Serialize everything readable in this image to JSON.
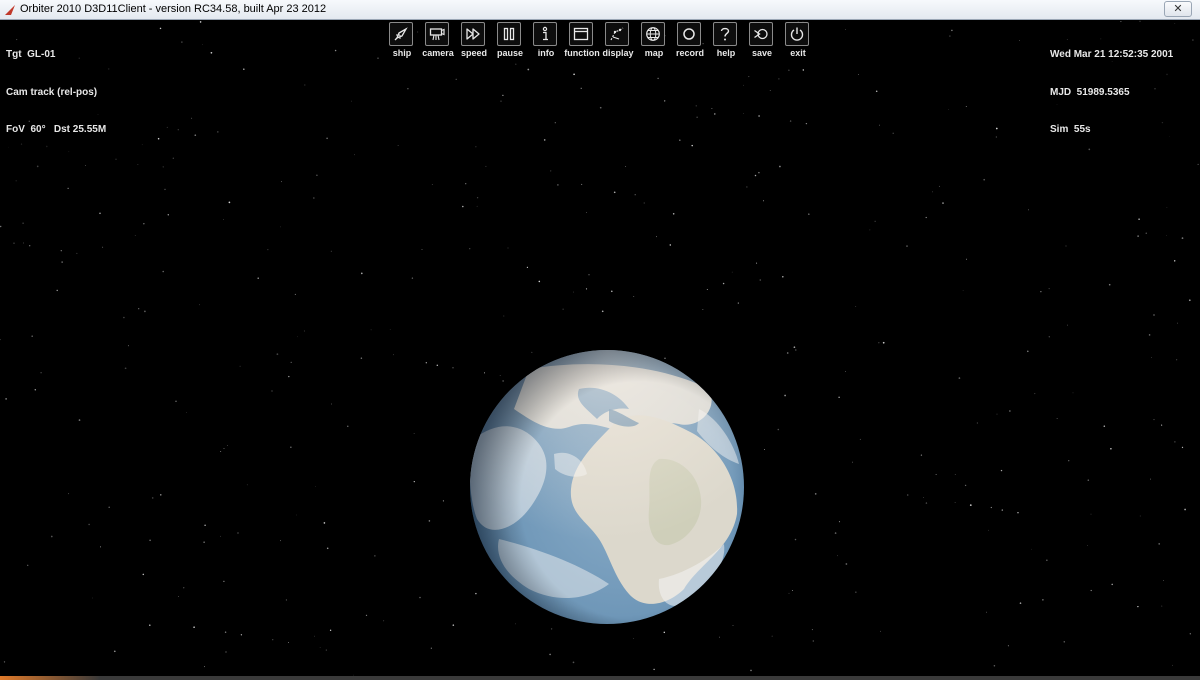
{
  "window": {
    "title": "Orbiter 2010 D3D11Client - version RC34.58, built Apr 23 2012",
    "close_glyph": "✕"
  },
  "hud_left": {
    "lines": [
      "Tgt  GL-01",
      "Cam track (rel-pos)",
      "FoV  60°   Dst 25.55M"
    ]
  },
  "hud_right": {
    "lines": [
      "Wed Mar 21 12:52:35 2001",
      "MJD  51989.5365",
      "Sim  55s"
    ]
  },
  "toolbar": {
    "buttons": [
      {
        "label": "ship",
        "icon": "rocket-icon"
      },
      {
        "label": "camera",
        "icon": "camera-icon"
      },
      {
        "label": "speed",
        "icon": "fast-forward-icon"
      },
      {
        "label": "pause",
        "icon": "pause-icon"
      },
      {
        "label": "info",
        "icon": "info-icon"
      },
      {
        "label": "function",
        "icon": "window-icon"
      },
      {
        "label": "display",
        "icon": "display-icon"
      },
      {
        "label": "map",
        "icon": "globe-icon"
      },
      {
        "label": "record",
        "icon": "record-icon"
      },
      {
        "label": "help",
        "icon": "help-icon"
      },
      {
        "label": "save",
        "icon": "save-icon"
      },
      {
        "label": "exit",
        "icon": "power-icon"
      }
    ]
  },
  "colors": {
    "ocean": "#6f97b8",
    "land": "#d9d6cc",
    "hud_text": "#e8e8e8",
    "space": "#000000"
  }
}
